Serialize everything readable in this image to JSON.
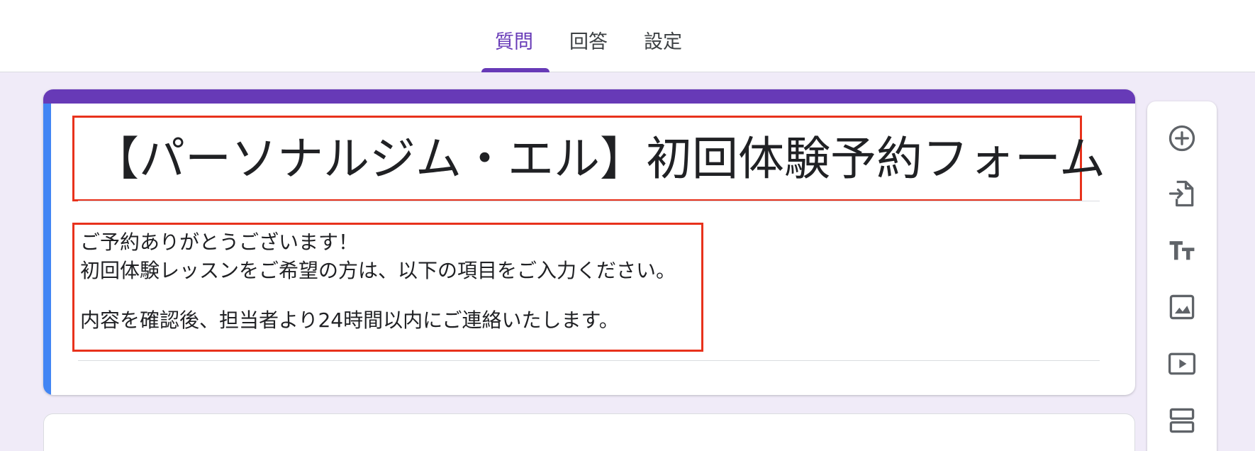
{
  "tabs": [
    {
      "label": "質問",
      "active": true
    },
    {
      "label": "回答",
      "active": false
    },
    {
      "label": "設定",
      "active": false
    }
  ],
  "form": {
    "title": "【パーソナルジム・エル】初回体験予約フォーム",
    "description_lines": [
      "ご予約ありがとうございます！",
      "初回体験レッスンをご希望の方は、以下の項目をご入力ください。",
      "内容を確認後、担当者より24時間以内にご連絡いたします。"
    ]
  },
  "toolbar": {
    "icons": [
      "add-question-icon",
      "import-questions-icon",
      "add-title-icon",
      "add-image-icon",
      "add-video-icon",
      "add-section-icon"
    ]
  },
  "colors": {
    "accent": "#673ab7",
    "focus_bar": "#4285f4",
    "highlight_box": "#e8321c",
    "background": "#f0ebf8"
  }
}
